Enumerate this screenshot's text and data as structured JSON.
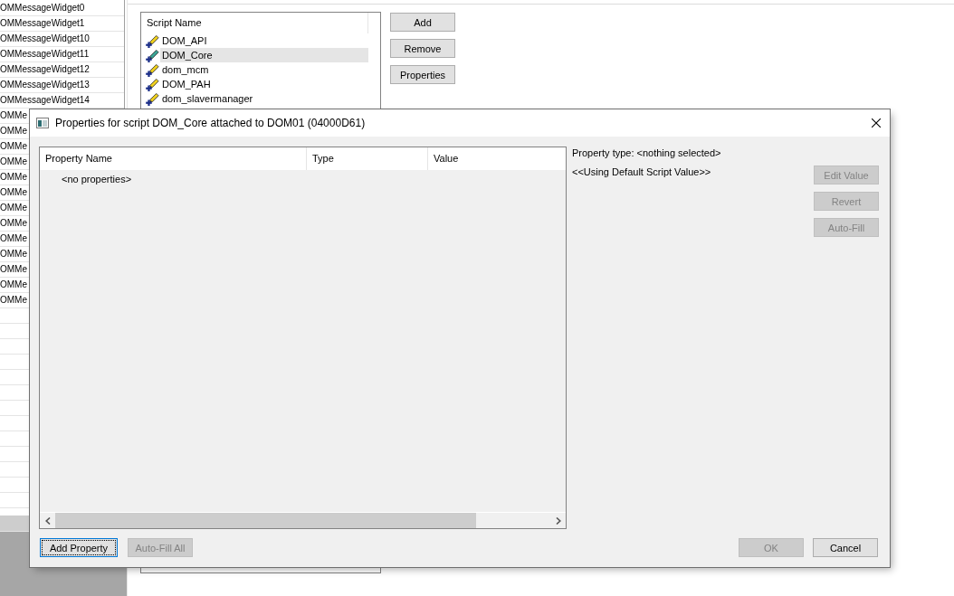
{
  "object_list": {
    "items": [
      {
        "label": "OMMessageWidget0",
        "selected": false
      },
      {
        "label": "OMMessageWidget1",
        "selected": false
      },
      {
        "label": "OMMessageWidget10",
        "selected": false
      },
      {
        "label": "OMMessageWidget11",
        "selected": false
      },
      {
        "label": "OMMessageWidget12",
        "selected": false
      },
      {
        "label": "OMMessageWidget13",
        "selected": false
      },
      {
        "label": "OMMessageWidget14",
        "selected": false
      },
      {
        "label": "OMMe",
        "selected": false
      },
      {
        "label": "OMMe",
        "selected": false
      },
      {
        "label": "OMMe",
        "selected": false
      },
      {
        "label": "OMMe",
        "selected": false
      },
      {
        "label": "OMMe",
        "selected": false
      },
      {
        "label": "OMMe",
        "selected": false
      },
      {
        "label": "OMMe",
        "selected": false
      },
      {
        "label": "OMMe",
        "selected": false
      },
      {
        "label": "OMMe",
        "selected": false
      },
      {
        "label": "OMMe",
        "selected": false
      },
      {
        "label": "OMMe",
        "selected": false
      },
      {
        "label": "OMMe",
        "selected": false
      },
      {
        "label": "OMMe",
        "selected": false
      }
    ]
  },
  "scripts_panel": {
    "list": {
      "columns": [
        "Script Name"
      ],
      "rows": [
        {
          "name": "DOM_API",
          "selected": false
        },
        {
          "name": "DOM_Core",
          "selected": true
        },
        {
          "name": "dom_mcm",
          "selected": false
        },
        {
          "name": "DOM_PAH",
          "selected": false
        },
        {
          "name": "dom_slavermanager",
          "selected": false
        }
      ]
    },
    "buttons": [
      {
        "label": "Add"
      },
      {
        "label": "Remove"
      },
      {
        "label": "Properties"
      }
    ]
  },
  "dialog": {
    "title": "Properties for script DOM_Core attached to DOM01 (04000D61)",
    "property_table": {
      "columns": [
        "Property Name",
        "Type",
        "Value"
      ],
      "empty_message": "<no properties>"
    },
    "property_type": "Property type: <nothing selected>",
    "value_note": "<<Using Default Script Value>>",
    "side_buttons": [
      {
        "label": "Edit Value",
        "disabled": true
      },
      {
        "label": "Revert",
        "disabled": true
      },
      {
        "label": "Auto-Fill",
        "disabled": true
      }
    ],
    "footer_left_buttons": [
      {
        "label": "Add Property",
        "disabled": false,
        "focused": true
      },
      {
        "label": "Auto-Fill All",
        "disabled": true,
        "focused": false
      }
    ],
    "footer_right_buttons": [
      {
        "label": "OK",
        "disabled": true
      },
      {
        "label": "Cancel",
        "disabled": false
      }
    ]
  }
}
